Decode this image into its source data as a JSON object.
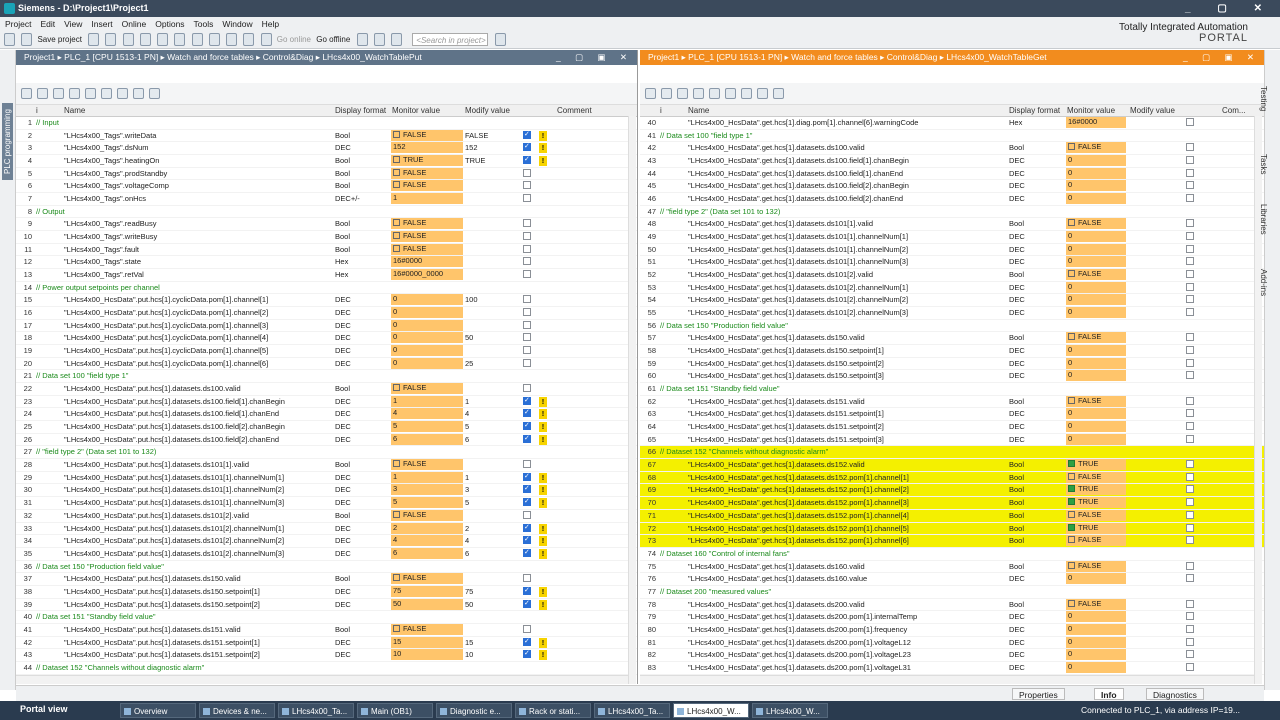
{
  "window": {
    "title": "Siemens - D:\\Project1\\Project1",
    "controls": [
      "_",
      "▢",
      "✕"
    ]
  },
  "menu": [
    "Project",
    "Edit",
    "View",
    "Insert",
    "Online",
    "Options",
    "Tools",
    "Window",
    "Help"
  ],
  "toolbar": {
    "save": "Save project",
    "go_online": "Go online",
    "go_offline": "Go offline",
    "search_placeholder": "<Search in project>"
  },
  "brand": {
    "line1": "Totally Integrated Automation",
    "line2": "PORTAL"
  },
  "left_strip": "PLC programming",
  "right_tabs": [
    "Testing",
    "Tasks",
    "Libraries",
    "Add-ins"
  ],
  "columns": {
    "name": "Name",
    "display": "Display format",
    "monitor": "Monitor value",
    "modify": "Modify value",
    "comment": "Comment",
    "comment_short": "Com..."
  },
  "left_pane": {
    "breadcrumb": "Project1  ▸  PLC_1 [CPU 1513-1 PN]  ▸  Watch and force tables  ▸  Control&Diag  ▸  LHcs4x00_WatchTablePut",
    "rows": [
      {
        "n": "1",
        "c": "// Input"
      },
      {
        "n": "2",
        "name": "\"LHcs4x00_Tags\".writeData",
        "f": "Bool",
        "mv": "FALSE",
        "mvb": "w",
        "md": "FALSE",
        "chk": "on",
        "w": true
      },
      {
        "n": "3",
        "name": "\"LHcs4x00_Tags\".dsNum",
        "f": "DEC",
        "mv": "152",
        "md": "152",
        "chk": "on",
        "w": true
      },
      {
        "n": "4",
        "name": "\"LHcs4x00_Tags\".heatingOn",
        "f": "Bool",
        "mv": "TRUE",
        "mvb": "w",
        "md": "TRUE",
        "chk": "on",
        "w": true
      },
      {
        "n": "5",
        "name": "\"LHcs4x00_Tags\".prodStandby",
        "f": "Bool",
        "mv": "FALSE",
        "mvb": "w",
        "chk": "off"
      },
      {
        "n": "6",
        "name": "\"LHcs4x00_Tags\".voltageComp",
        "f": "Bool",
        "mv": "FALSE",
        "mvb": "w",
        "chk": "off"
      },
      {
        "n": "7",
        "name": "\"LHcs4x00_Tags\".onHcs",
        "f": "DEC+/-",
        "mv": "1",
        "chk": "off"
      },
      {
        "n": "8",
        "c": "// Output"
      },
      {
        "n": "9",
        "name": "\"LHcs4x00_Tags\".readBusy",
        "f": "Bool",
        "mv": "FALSE",
        "mvb": "w",
        "chk": "off"
      },
      {
        "n": "10",
        "name": "\"LHcs4x00_Tags\".writeBusy",
        "f": "Bool",
        "mv": "FALSE",
        "mvb": "w",
        "chk": "off"
      },
      {
        "n": "11",
        "name": "\"LHcs4x00_Tags\".fault",
        "f": "Bool",
        "mv": "FALSE",
        "mvb": "w",
        "chk": "off"
      },
      {
        "n": "12",
        "name": "\"LHcs4x00_Tags\".state",
        "f": "Hex",
        "mv": "16#0000",
        "chk": "off"
      },
      {
        "n": "13",
        "name": "\"LHcs4x00_Tags\".retVal",
        "f": "Hex",
        "mv": "16#0000_0000",
        "chk": "off"
      },
      {
        "n": "14",
        "c": "// Power output setpoints per channel"
      },
      {
        "n": "15",
        "name": "\"LHcs4x00_HcsData\".put.hcs[1].cyclicData.pom[1].channel[1]",
        "f": "DEC",
        "mv": "0",
        "md": "100",
        "chk": "off"
      },
      {
        "n": "16",
        "name": "\"LHcs4x00_HcsData\".put.hcs[1].cyclicData.pom[1].channel[2]",
        "f": "DEC",
        "mv": "0",
        "chk": "off"
      },
      {
        "n": "17",
        "name": "\"LHcs4x00_HcsData\".put.hcs[1].cyclicData.pom[1].channel[3]",
        "f": "DEC",
        "mv": "0",
        "chk": "off"
      },
      {
        "n": "18",
        "name": "\"LHcs4x00_HcsData\".put.hcs[1].cyclicData.pom[1].channel[4]",
        "f": "DEC",
        "mv": "0",
        "md": "50",
        "chk": "off"
      },
      {
        "n": "19",
        "name": "\"LHcs4x00_HcsData\".put.hcs[1].cyclicData.pom[1].channel[5]",
        "f": "DEC",
        "mv": "0",
        "chk": "off"
      },
      {
        "n": "20",
        "name": "\"LHcs4x00_HcsData\".put.hcs[1].cyclicData.pom[1].channel[6]",
        "f": "DEC",
        "mv": "0",
        "md": "25",
        "chk": "off"
      },
      {
        "n": "21",
        "c": "// Data set 100 \"field type 1\""
      },
      {
        "n": "22",
        "name": "\"LHcs4x00_HcsData\".put.hcs[1].datasets.ds100.valid",
        "f": "Bool",
        "mv": "FALSE",
        "mvb": "w",
        "chk": "off"
      },
      {
        "n": "23",
        "name": "\"LHcs4x00_HcsData\".put.hcs[1].datasets.ds100.field[1].chanBegin",
        "f": "DEC",
        "mv": "1",
        "md": "1",
        "chk": "on",
        "w": true
      },
      {
        "n": "24",
        "name": "\"LHcs4x00_HcsData\".put.hcs[1].datasets.ds100.field[1].chanEnd",
        "f": "DEC",
        "mv": "4",
        "md": "4",
        "chk": "on",
        "w": true
      },
      {
        "n": "25",
        "name": "\"LHcs4x00_HcsData\".put.hcs[1].datasets.ds100.field[2].chanBegin",
        "f": "DEC",
        "mv": "5",
        "md": "5",
        "chk": "on",
        "w": true
      },
      {
        "n": "26",
        "name": "\"LHcs4x00_HcsData\".put.hcs[1].datasets.ds100.field[2].chanEnd",
        "f": "DEC",
        "mv": "6",
        "md": "6",
        "chk": "on",
        "w": true
      },
      {
        "n": "27",
        "c": "// \"field type 2\" (Data set 101 to 132)"
      },
      {
        "n": "28",
        "name": "\"LHcs4x00_HcsData\".put.hcs[1].datasets.ds101[1].valid",
        "f": "Bool",
        "mv": "FALSE",
        "mvb": "w",
        "chk": "off"
      },
      {
        "n": "29",
        "name": "\"LHcs4x00_HcsData\".put.hcs[1].datasets.ds101[1].channelNum[1]",
        "f": "DEC",
        "mv": "1",
        "md": "1",
        "chk": "on",
        "w": true
      },
      {
        "n": "30",
        "name": "\"LHcs4x00_HcsData\".put.hcs[1].datasets.ds101[1].channelNum[2]",
        "f": "DEC",
        "mv": "3",
        "md": "3",
        "chk": "on",
        "w": true
      },
      {
        "n": "31",
        "name": "\"LHcs4x00_HcsData\".put.hcs[1].datasets.ds101[1].channelNum[3]",
        "f": "DEC",
        "mv": "5",
        "md": "5",
        "chk": "on",
        "w": true
      },
      {
        "n": "32",
        "name": "\"LHcs4x00_HcsData\".put.hcs[1].datasets.ds101[2].valid",
        "f": "Bool",
        "mv": "FALSE",
        "mvb": "w",
        "chk": "off"
      },
      {
        "n": "33",
        "name": "\"LHcs4x00_HcsData\".put.hcs[1].datasets.ds101[2].channelNum[1]",
        "f": "DEC",
        "mv": "2",
        "md": "2",
        "chk": "on",
        "w": true
      },
      {
        "n": "34",
        "name": "\"LHcs4x00_HcsData\".put.hcs[1].datasets.ds101[2].channelNum[2]",
        "f": "DEC",
        "mv": "4",
        "md": "4",
        "chk": "on",
        "w": true
      },
      {
        "n": "35",
        "name": "\"LHcs4x00_HcsData\".put.hcs[1].datasets.ds101[2].channelNum[3]",
        "f": "DEC",
        "mv": "6",
        "md": "6",
        "chk": "on",
        "w": true
      },
      {
        "n": "36",
        "c": "// Data set 150 \"Production field value\""
      },
      {
        "n": "37",
        "name": "\"LHcs4x00_HcsData\".put.hcs[1].datasets.ds150.valid",
        "f": "Bool",
        "mv": "FALSE",
        "mvb": "w",
        "chk": "off"
      },
      {
        "n": "38",
        "name": "\"LHcs4x00_HcsData\".put.hcs[1].datasets.ds150.setpoint[1]",
        "f": "DEC",
        "mv": "75",
        "md": "75",
        "chk": "on",
        "w": true
      },
      {
        "n": "39",
        "name": "\"LHcs4x00_HcsData\".put.hcs[1].datasets.ds150.setpoint[2]",
        "f": "DEC",
        "mv": "50",
        "md": "50",
        "chk": "on",
        "w": true
      },
      {
        "n": "40",
        "c": "// Data set 151 \"Standby field value\""
      },
      {
        "n": "41",
        "name": "\"LHcs4x00_HcsData\".put.hcs[1].datasets.ds151.valid",
        "f": "Bool",
        "mv": "FALSE",
        "mvb": "w",
        "chk": "off"
      },
      {
        "n": "42",
        "name": "\"LHcs4x00_HcsData\".put.hcs[1].datasets.ds151.setpoint[1]",
        "f": "DEC",
        "mv": "15",
        "md": "15",
        "chk": "on",
        "w": true
      },
      {
        "n": "43",
        "name": "\"LHcs4x00_HcsData\".put.hcs[1].datasets.ds151.setpoint[2]",
        "f": "DEC",
        "mv": "10",
        "md": "10",
        "chk": "on",
        "w": true
      },
      {
        "n": "44",
        "c": "// Dataset 152 \"Channels without diagnostic alarm\""
      }
    ]
  },
  "right_pane": {
    "breadcrumb": "Project1  ▸  PLC_1 [CPU 1513-1 PN]  ▸  Watch and force tables  ▸  Control&Diag  ▸  LHcs4x00_WatchTableGet",
    "rows": [
      {
        "n": "40",
        "name": "\"LHcs4x00_HcsData\".get.hcs[1].diag.pom[1].channel[6].warningCode",
        "f": "Hex",
        "mv": "16#0000",
        "chk": "off"
      },
      {
        "n": "41",
        "c": "// Data set 100 \"field type 1\""
      },
      {
        "n": "42",
        "name": "\"LHcs4x00_HcsData\".get.hcs[1].datasets.ds100.valid",
        "f": "Bool",
        "mv": "FALSE",
        "mvb": "w",
        "chk": "off"
      },
      {
        "n": "43",
        "name": "\"LHcs4x00_HcsData\".get.hcs[1].datasets.ds100.field[1].chanBegin",
        "f": "DEC",
        "mv": "0",
        "chk": "off"
      },
      {
        "n": "44",
        "name": "\"LHcs4x00_HcsData\".get.hcs[1].datasets.ds100.field[1].chanEnd",
        "f": "DEC",
        "mv": "0",
        "chk": "off"
      },
      {
        "n": "45",
        "name": "\"LHcs4x00_HcsData\".get.hcs[1].datasets.ds100.field[2].chanBegin",
        "f": "DEC",
        "mv": "0",
        "chk": "off"
      },
      {
        "n": "46",
        "name": "\"LHcs4x00_HcsData\".get.hcs[1].datasets.ds100.field[2].chanEnd",
        "f": "DEC",
        "mv": "0",
        "chk": "off"
      },
      {
        "n": "47",
        "c": "// \"field type 2\" (Data set 101 to 132)"
      },
      {
        "n": "48",
        "name": "\"LHcs4x00_HcsData\".get.hcs[1].datasets.ds101[1].valid",
        "f": "Bool",
        "mv": "FALSE",
        "mvb": "w",
        "chk": "off"
      },
      {
        "n": "49",
        "name": "\"LHcs4x00_HcsData\".get.hcs[1].datasets.ds101[1].channelNum[1]",
        "f": "DEC",
        "mv": "0",
        "chk": "off"
      },
      {
        "n": "50",
        "name": "\"LHcs4x00_HcsData\".get.hcs[1].datasets.ds101[1].channelNum[2]",
        "f": "DEC",
        "mv": "0",
        "chk": "off"
      },
      {
        "n": "51",
        "name": "\"LHcs4x00_HcsData\".get.hcs[1].datasets.ds101[1].channelNum[3]",
        "f": "DEC",
        "mv": "0",
        "chk": "off"
      },
      {
        "n": "52",
        "name": "\"LHcs4x00_HcsData\".get.hcs[1].datasets.ds101[2].valid",
        "f": "Bool",
        "mv": "FALSE",
        "mvb": "w",
        "chk": "off"
      },
      {
        "n": "53",
        "name": "\"LHcs4x00_HcsData\".get.hcs[1].datasets.ds101[2].channelNum[1]",
        "f": "DEC",
        "mv": "0",
        "chk": "off"
      },
      {
        "n": "54",
        "name": "\"LHcs4x00_HcsData\".get.hcs[1].datasets.ds101[2].channelNum[2]",
        "f": "DEC",
        "mv": "0",
        "chk": "off"
      },
      {
        "n": "55",
        "name": "\"LHcs4x00_HcsData\".get.hcs[1].datasets.ds101[2].channelNum[3]",
        "f": "DEC",
        "mv": "0",
        "chk": "off"
      },
      {
        "n": "56",
        "c": "// Data set 150 \"Production field value\""
      },
      {
        "n": "57",
        "name": "\"LHcs4x00_HcsData\".get.hcs[1].datasets.ds150.valid",
        "f": "Bool",
        "mv": "FALSE",
        "mvb": "w",
        "chk": "off"
      },
      {
        "n": "58",
        "name": "\"LHcs4x00_HcsData\".get.hcs[1].datasets.ds150.setpoint[1]",
        "f": "DEC",
        "mv": "0",
        "chk": "off"
      },
      {
        "n": "59",
        "name": "\"LHcs4x00_HcsData\".get.hcs[1].datasets.ds150.setpoint[2]",
        "f": "DEC",
        "mv": "0",
        "chk": "off"
      },
      {
        "n": "60",
        "name": "\"LHcs4x00_HcsData\".get.hcs[1].datasets.ds150.setpoint[3]",
        "f": "DEC",
        "mv": "0",
        "chk": "off"
      },
      {
        "n": "61",
        "c": "// Data set 151 \"Standby field value\""
      },
      {
        "n": "62",
        "name": "\"LHcs4x00_HcsData\".get.hcs[1].datasets.ds151.valid",
        "f": "Bool",
        "mv": "FALSE",
        "mvb": "w",
        "chk": "off"
      },
      {
        "n": "63",
        "name": "\"LHcs4x00_HcsData\".get.hcs[1].datasets.ds151.setpoint[1]",
        "f": "DEC",
        "mv": "0",
        "chk": "off"
      },
      {
        "n": "64",
        "name": "\"LHcs4x00_HcsData\".get.hcs[1].datasets.ds151.setpoint[2]",
        "f": "DEC",
        "mv": "0",
        "chk": "off"
      },
      {
        "n": "65",
        "name": "\"LHcs4x00_HcsData\".get.hcs[1].datasets.ds151.setpoint[3]",
        "f": "DEC",
        "mv": "0",
        "chk": "off"
      },
      {
        "n": "66",
        "c": "// Dataset 152 \"Channels without diagnostic alarm\"",
        "hl": true
      },
      {
        "n": "67",
        "name": "\"LHcs4x00_HcsData\".get.hcs[1].datasets.ds152.valid",
        "f": "Bool",
        "mv": "TRUE",
        "mvb": "g",
        "chk": "off",
        "hl": true
      },
      {
        "n": "68",
        "name": "\"LHcs4x00_HcsData\".get.hcs[1].datasets.ds152.pom[1].channel[1]",
        "f": "Bool",
        "mv": "FALSE",
        "mvb": "w",
        "chk": "off",
        "hl": true
      },
      {
        "n": "69",
        "name": "\"LHcs4x00_HcsData\".get.hcs[1].datasets.ds152.pom[1].channel[2]",
        "f": "Bool",
        "mv": "TRUE",
        "mvb": "g",
        "chk": "off",
        "hl": true
      },
      {
        "n": "70",
        "name": "\"LHcs4x00_HcsData\".get.hcs[1].datasets.ds152.pom[1].channel[3]",
        "f": "Bool",
        "mv": "TRUE",
        "mvb": "g",
        "chk": "off",
        "hl": true
      },
      {
        "n": "71",
        "name": "\"LHcs4x00_HcsData\".get.hcs[1].datasets.ds152.pom[1].channel[4]",
        "f": "Bool",
        "mv": "FALSE",
        "mvb": "w",
        "chk": "off",
        "hl": true
      },
      {
        "n": "72",
        "name": "\"LHcs4x00_HcsData\".get.hcs[1].datasets.ds152.pom[1].channel[5]",
        "f": "Bool",
        "mv": "TRUE",
        "mvb": "g",
        "chk": "off",
        "hl": true
      },
      {
        "n": "73",
        "name": "\"LHcs4x00_HcsData\".get.hcs[1].datasets.ds152.pom[1].channel[6]",
        "f": "Bool",
        "mv": "FALSE",
        "mvb": "w",
        "chk": "off",
        "hl": true
      },
      {
        "n": "74",
        "c": "// Dataset 160 \"Control of internal fans\""
      },
      {
        "n": "75",
        "name": "\"LHcs4x00_HcsData\".get.hcs[1].datasets.ds160.valid",
        "f": "Bool",
        "mv": "FALSE",
        "mvb": "w",
        "chk": "off"
      },
      {
        "n": "76",
        "name": "\"LHcs4x00_HcsData\".get.hcs[1].datasets.ds160.value",
        "f": "DEC",
        "mv": "0",
        "chk": "off"
      },
      {
        "n": "77",
        "c": "// Dataset 200 \"measured values\""
      },
      {
        "n": "78",
        "name": "\"LHcs4x00_HcsData\".get.hcs[1].datasets.ds200.valid",
        "f": "Bool",
        "mv": "FALSE",
        "mvb": "w",
        "chk": "off"
      },
      {
        "n": "79",
        "name": "\"LHcs4x00_HcsData\".get.hcs[1].datasets.ds200.pom[1].internalTemp",
        "f": "DEC",
        "mv": "0",
        "chk": "off"
      },
      {
        "n": "80",
        "name": "\"LHcs4x00_HcsData\".get.hcs[1].datasets.ds200.pom[1].frequency",
        "f": "DEC",
        "mv": "0",
        "chk": "off"
      },
      {
        "n": "81",
        "name": "\"LHcs4x00_HcsData\".get.hcs[1].datasets.ds200.pom[1].voltageL12",
        "f": "DEC",
        "mv": "0",
        "chk": "off"
      },
      {
        "n": "82",
        "name": "\"LHcs4x00_HcsData\".get.hcs[1].datasets.ds200.pom[1].voltageL23",
        "f": "DEC",
        "mv": "0",
        "chk": "off"
      },
      {
        "n": "83",
        "name": "\"LHcs4x00_HcsData\".get.hcs[1].datasets.ds200.pom[1].voltageL31",
        "f": "DEC",
        "mv": "0",
        "chk": "off"
      }
    ]
  },
  "inspector_tabs": [
    "Properties",
    "Info",
    "Diagnostics"
  ],
  "portal_view": "Portal view",
  "taskbar": [
    "Overview",
    "Devices & ne...",
    "LHcs4x00_Ta...",
    "Main (OB1)",
    "Diagnostic e...",
    "Rack or stati...",
    "LHcs4x00_Ta...",
    "LHcs4x00_W...",
    "LHcs4x00_W..."
  ],
  "taskbar_active": 7,
  "status": "Connected to PLC_1, via address IP=19..."
}
